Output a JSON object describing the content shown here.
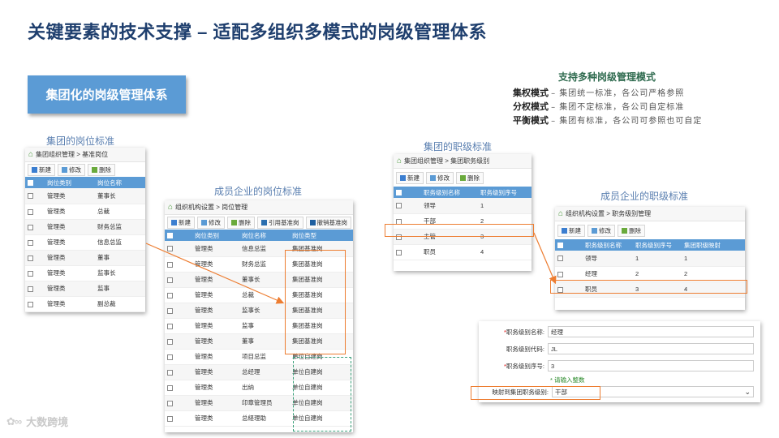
{
  "title": "关键要素的技术支撑 – 适配多组织多模式的岗级管理体系",
  "banner": "集团化的岗级管理体系",
  "captions": {
    "group_post": "集团的岗位标准",
    "member_post": "成员企业的岗位标准",
    "group_grade": "集团的职级标准",
    "member_grade": "成员企业的职级标准"
  },
  "modes": {
    "heading": "支持多种岗级管理模式",
    "items": [
      {
        "name": "集权模式",
        "desc": "– 集团统一标准，各公司严格参照"
      },
      {
        "name": "分权模式",
        "desc": "– 集团不定标准，各公司自定标准"
      },
      {
        "name": "平衡模式",
        "desc": "– 集团有标准，各公司可参照也可自定"
      }
    ]
  },
  "panel_group_post": {
    "crumb": "集团组织管理 > 基准岗位",
    "buttons": [
      "新建",
      "修改",
      "删除"
    ],
    "headers": [
      "岗位类别",
      "岗位名称"
    ],
    "rows": [
      [
        "管理类",
        "董事长"
      ],
      [
        "管理类",
        "总裁"
      ],
      [
        "管理类",
        "财务总监"
      ],
      [
        "管理类",
        "信息总监"
      ],
      [
        "管理类",
        "董事"
      ],
      [
        "管理类",
        "监事长"
      ],
      [
        "管理类",
        "监事"
      ],
      [
        "管理类",
        "副总裁"
      ]
    ]
  },
  "panel_member_post": {
    "crumb": "组织机构设置 > 岗位管理",
    "buttons": [
      "新建",
      "修改",
      "删除",
      "引用基准岗",
      "撤销基准岗"
    ],
    "headers": [
      "岗位类别",
      "岗位名称",
      "岗位类型"
    ],
    "rows": [
      [
        "管理类",
        "信息总监",
        "集团基准岗"
      ],
      [
        "管理类",
        "财务总监",
        "集团基准岗"
      ],
      [
        "管理类",
        "董事长",
        "集团基准岗"
      ],
      [
        "管理类",
        "总裁",
        "集团基准岗"
      ],
      [
        "管理类",
        "监事长",
        "集团基准岗"
      ],
      [
        "管理类",
        "监事",
        "集团基准岗"
      ],
      [
        "管理类",
        "董事",
        "集团基准岗"
      ],
      [
        "管理类",
        "项目总监",
        "单位自建岗"
      ],
      [
        "管理类",
        "总经理",
        "单位自建岗"
      ],
      [
        "管理类",
        "出纳",
        "单位自建岗"
      ],
      [
        "管理类",
        "印章管理员",
        "单位自建岗"
      ],
      [
        "管理类",
        "总経理助",
        "单位自建岗"
      ]
    ]
  },
  "panel_group_grade": {
    "crumb": "集团组织管理 > 集团职务级别",
    "buttons": [
      "新建",
      "修改",
      "删除"
    ],
    "headers": [
      "职务级别名称",
      "职务级别序号"
    ],
    "rows": [
      [
        "领导",
        "1"
      ],
      [
        "干部",
        "2"
      ],
      [
        "主管",
        "3"
      ],
      [
        "职员",
        "4"
      ]
    ]
  },
  "panel_member_grade": {
    "crumb": "组织机构设置 > 职务级别管理",
    "buttons": [
      "新建",
      "修改",
      "删除"
    ],
    "headers": [
      "职务级别名称",
      "职务级别序号",
      "集团职级映射"
    ],
    "rows": [
      [
        "领导",
        "1",
        "1"
      ],
      [
        "经理",
        "2",
        "2"
      ],
      [
        "职员",
        "3",
        "4"
      ]
    ]
  },
  "form": {
    "fields": [
      {
        "label": "职务级别名称:",
        "required": true,
        "value": "经理"
      },
      {
        "label": "职务级别代码:",
        "required": false,
        "value": "JL"
      },
      {
        "label": "职务级别序号:",
        "required": true,
        "value": "3"
      }
    ],
    "hint": "* 请输入整数",
    "mapping_label": "映射到集团职务级别:",
    "mapping_value": "干部"
  },
  "logo_text": "大数跨境"
}
